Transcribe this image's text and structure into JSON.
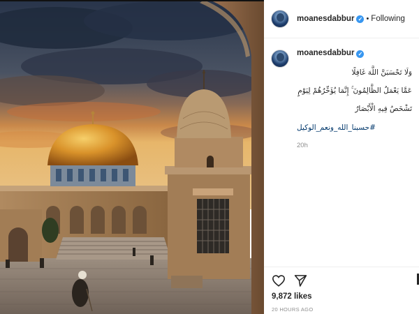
{
  "post": {
    "username": "moanesdabbur",
    "verified_icon": "verified-badge-icon",
    "dot": "•",
    "follow_state": "Following",
    "caption_line_1": "وَلَا تَحْسَبَنَّ اللَّهَ غَافِلًا",
    "caption_line_2": "عَمَّا يَعْمَلُ الظَّالِمُونَ ۚ إِنَّمَا يُؤَخِّرُهُمْ لِيَوْمٍ",
    "caption_line_3": "تَشْخَصُ فِيهِ الْأَبْصَارُ",
    "hashtag": "#حسبنا_الله_ونعم_الوكيل",
    "comment_age": "20h",
    "likes": "9,872 likes",
    "posted_ago": "20 HOURS AGO"
  },
  "icons": {
    "like": "heart-icon",
    "share": "paper-plane-icon",
    "avatar": "avatar"
  },
  "colors": {
    "verified": "#3897f0",
    "hashtag": "#00376b",
    "muted": "#8e8e8e",
    "dome_gold": "#d9922a",
    "sky_dark": "#2f3b4f"
  }
}
